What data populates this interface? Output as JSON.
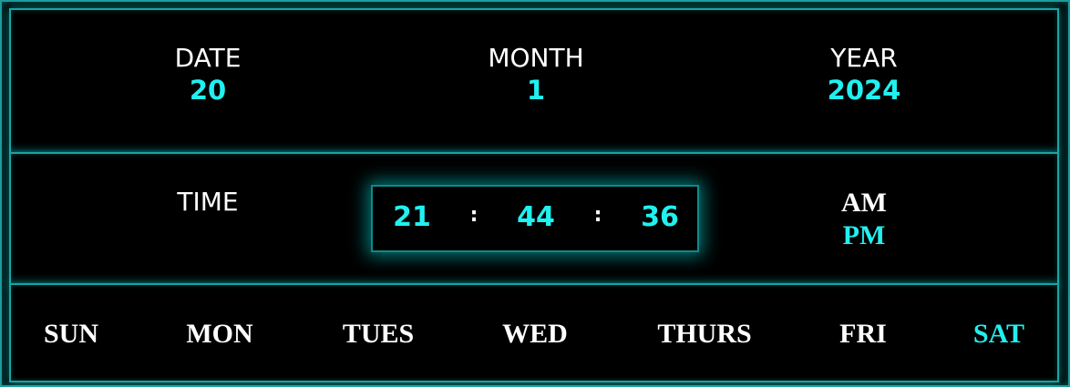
{
  "date_section": {
    "date_label": "DATE",
    "date_value": "20",
    "month_label": "MONTH",
    "month_value": "1",
    "year_label": "YEAR",
    "year_value": "2024"
  },
  "time_section": {
    "time_label": "TIME",
    "hours": "21",
    "minutes": "44",
    "seconds": "36",
    "separator": ":",
    "am_label": "AM",
    "pm_label": "PM",
    "active_period": "PM"
  },
  "days": [
    {
      "label": "SUN",
      "active": false
    },
    {
      "label": "MON",
      "active": false
    },
    {
      "label": "TUES",
      "active": false
    },
    {
      "label": "WED",
      "active": false
    },
    {
      "label": "THURS",
      "active": false
    },
    {
      "label": "FRI",
      "active": false
    },
    {
      "label": "SAT",
      "active": true
    }
  ],
  "colors": {
    "background": "#000000",
    "accent": "#21f0f0",
    "text": "#ffffff",
    "border": "#1aa3a3"
  }
}
